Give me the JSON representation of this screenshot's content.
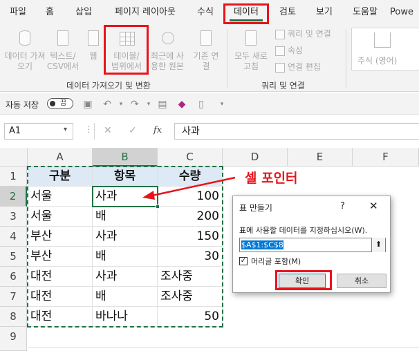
{
  "ribbon_tabs": [
    "파일",
    "홈",
    "삽입",
    "페이지 레이아웃",
    "수식",
    "데이터",
    "검토",
    "보기",
    "도움말",
    "Powe"
  ],
  "active_tab": "데이터",
  "ribbon": {
    "get_data": "데이터 가져오기",
    "text_csv": "텍스트/ CSV에서",
    "web": "웹",
    "from_table": "테이블/ 범위에서",
    "recent_sources": "최근에 사용한 원본",
    "existing_conn": "기존 연결",
    "refresh_all": "모두 새로 고침",
    "queries_conn": "쿼리 및 연결",
    "properties": "속성",
    "edit_links": "연결 편집",
    "stocks": "주식 (영어)",
    "group_get_transform": "데이터 가져오기 및 변환",
    "group_queries": "쿼리 및 연결"
  },
  "qat": {
    "autosave": "자동 저장",
    "toggle": "끔"
  },
  "formula_bar": {
    "name_box": "A1",
    "formula": "사과"
  },
  "columns": [
    "A",
    "B",
    "C",
    "D",
    "E",
    "F"
  ],
  "rows": [
    "1",
    "2",
    "3",
    "4",
    "5",
    "6",
    "7",
    "8",
    "9"
  ],
  "table": {
    "header": [
      "구분",
      "항목",
      "수량"
    ],
    "rows": [
      [
        "서울",
        "사과",
        "100"
      ],
      [
        "서울",
        "배",
        "200"
      ],
      [
        "부산",
        "사과",
        "150"
      ],
      [
        "부산",
        "배",
        "30"
      ],
      [
        "대전",
        "사과",
        "조사중"
      ],
      [
        "대전",
        "배",
        "조사중"
      ],
      [
        "대전",
        "바나나",
        "50"
      ]
    ]
  },
  "annotation": "셀 포인터",
  "dialog": {
    "title": "표 만들기",
    "help": "?",
    "close": "✕",
    "prompt": "표에 사용할 데이터를 지정하십시오(W).",
    "range": "$A$1:$C$8",
    "collapse": "⬆",
    "has_headers": "머리글 포함(M)",
    "checked": "✓",
    "ok": "확인",
    "cancel": "취소"
  },
  "colors": {
    "accent": "#217346",
    "highlight": "#e8131a",
    "table_header": "#dde9f5"
  }
}
